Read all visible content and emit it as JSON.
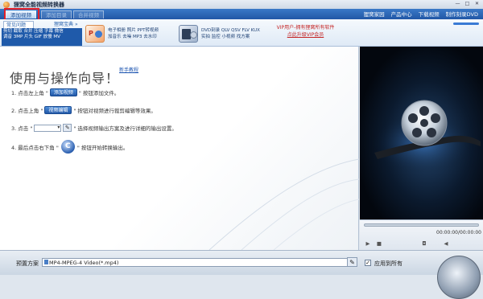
{
  "window": {
    "title": "狸窝全能视频转换器",
    "controls": [
      "—",
      "□",
      "✕"
    ]
  },
  "tabs": {
    "items": [
      "添加视频",
      "添加目录",
      "合并视频"
    ]
  },
  "top_menu": [
    "狸窝家园",
    "产品中心",
    "下载视频",
    "制作刻录DVD"
  ],
  "banner": {
    "tab_active": "常见问题",
    "tab_other": "狸窝宝典",
    "tab_arrow": "»",
    "left_panel_lines": [
      "剪切 截取 合并 压缩 字幕 微信",
      "调音 3MP 片头 GIF 放慢 MV"
    ],
    "features": [
      {
        "lines": [
          "电子相册 照片 PPT转视频",
          "加音乐 去噪 MP3 去水印"
        ],
        "icon_color": "#d9442f"
      },
      {
        "lines": [
          "DVD刻录 QLV QSV FLV KUX",
          "实拍 监控 小视频 找方案"
        ],
        "icon_color": "#3b6fb7"
      }
    ],
    "vip_line1": "VIP用户-拥有狸窝所有软件",
    "vip_line2": "点此升级VIP会员"
  },
  "guide": {
    "title": "使用与操作向导！",
    "link": "新手教程",
    "step1_prefix": "1. 点击左上角 \"",
    "step1_button": "添加视频",
    "step1_suffix": "\" 按钮添加文件。",
    "step2_prefix": "2. 点击上角 \"",
    "step2_button": "视频编辑",
    "step2_suffix": "\" 按钮对视频进行裁剪编辑等效果。",
    "step3_prefix": "3. 点击 \"",
    "step3_suffix": "\" 选择视频输出方案及进行详细的输出设置。",
    "step4_prefix": "4. 最后点击右下角 \"",
    "step4_suffix": "\" 按钮开始转换输出。"
  },
  "player": {
    "time_start": "00:00:00",
    "time_end": "00:00:00",
    "controls": [
      "▶",
      "■"
    ],
    "camera_icon": "camera-icon",
    "volume_icon": "speaker-icon"
  },
  "bottom": {
    "preset_label": "预置方案",
    "preset_value": "MP4-MPEG-4 Video(*.mp4)",
    "apply_all_label": "应用到所有",
    "apply_all_checked": "✓"
  }
}
